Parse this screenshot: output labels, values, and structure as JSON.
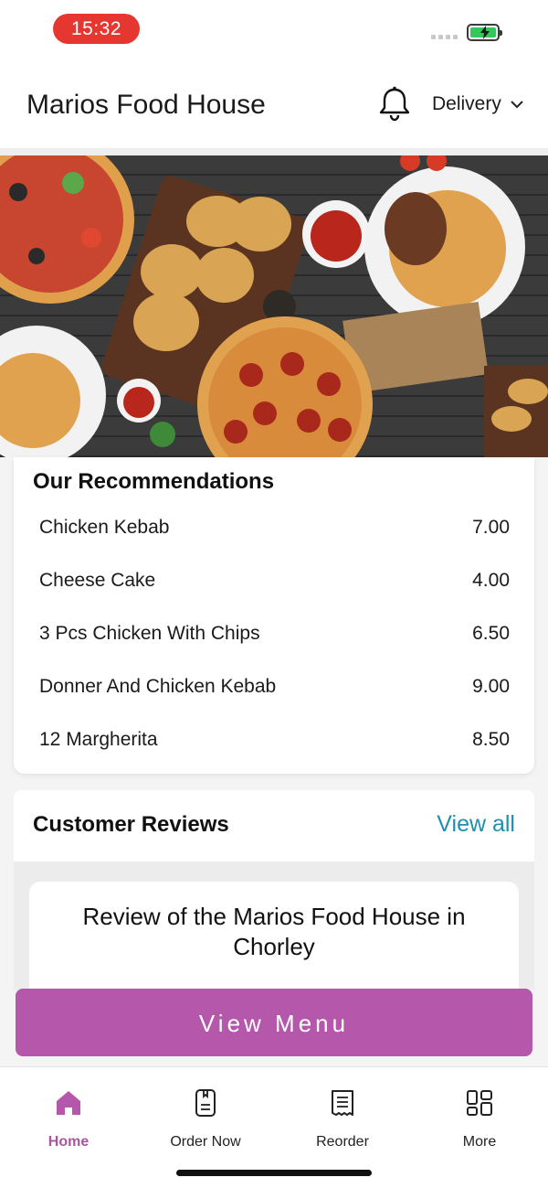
{
  "status_bar": {
    "time": "15:32"
  },
  "header": {
    "title": "Marios Food House",
    "mode_label": "Delivery"
  },
  "hero": {
    "image": "food-spread-banner",
    "alt": ""
  },
  "recommendations": {
    "title": "Our Recommendations",
    "items": [
      {
        "name": "Chicken Kebab",
        "price": "7.00"
      },
      {
        "name": "Cheese Cake",
        "price": "4.00"
      },
      {
        "name": "3 Pcs Chicken With Chips",
        "price": "6.50"
      },
      {
        "name": "Donner And Chicken Kebab",
        "price": "9.00"
      },
      {
        "name": "12 Margherita",
        "price": "8.50"
      }
    ]
  },
  "reviews": {
    "title": "Customer Reviews",
    "view_all_label": "View all",
    "card_heading": "Review of the Marios Food House in Chorley"
  },
  "cta": {
    "label": "View Menu"
  },
  "tabbar": {
    "tabs": [
      {
        "label": "Home",
        "icon": "home-icon",
        "active": true
      },
      {
        "label": "Order Now",
        "icon": "order-icon",
        "active": false
      },
      {
        "label": "Reorder",
        "icon": "receipt-icon",
        "active": false
      },
      {
        "label": "More",
        "icon": "grid-icon",
        "active": false
      }
    ]
  },
  "colors": {
    "accent": "#b557aa",
    "link": "#1f8fb0",
    "time_pill": "#e5372f",
    "battery": "#34c759"
  }
}
